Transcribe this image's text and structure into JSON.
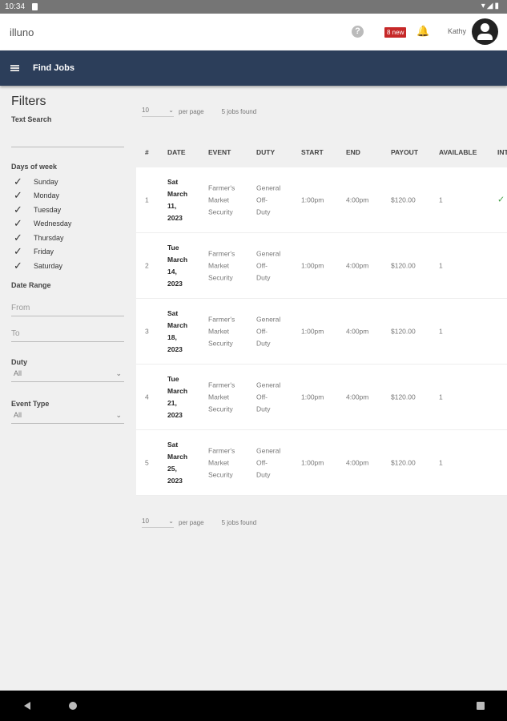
{
  "status": {
    "time": "10:34",
    "icons": "▾◢▮"
  },
  "header": {
    "app_title": "illuno",
    "help": "?",
    "badge": "8 new",
    "bell": "🔔",
    "user": "Kathy"
  },
  "nav": {
    "title": "Find Jobs"
  },
  "filters": {
    "title": "Filters",
    "text_search_label": "Text Search",
    "days_label": "Days of week",
    "days": [
      "Sunday",
      "Monday",
      "Tuesday",
      "Wednesday",
      "Thursday",
      "Friday",
      "Saturday"
    ],
    "date_range_label": "Date Range",
    "from_placeholder": "From",
    "to_placeholder": "To",
    "duty_label": "Duty",
    "duty_value": "All",
    "event_type_label": "Event Type",
    "event_type_value": "All"
  },
  "pager": {
    "per_page_value": "10",
    "per_page_label": "per page",
    "found": "5 jobs found"
  },
  "table": {
    "columns": [
      "#",
      "DATE",
      "EVENT",
      "DUTY",
      "START",
      "END",
      "PAYOUT",
      "AVAILABLE",
      "INT"
    ],
    "rows": [
      {
        "n": "1",
        "date": [
          "Sat",
          "March",
          "11,",
          "2023"
        ],
        "event": [
          "Farmer's",
          "Market",
          "Security"
        ],
        "duty": [
          "General",
          "Off-",
          "Duty"
        ],
        "start": "1:00pm",
        "end": "4:00pm",
        "payout": "$120.00",
        "available": "1",
        "int": "✓"
      },
      {
        "n": "2",
        "date": [
          "Tue",
          "March",
          "14,",
          "2023"
        ],
        "event": [
          "Farmer's",
          "Market",
          "Security"
        ],
        "duty": [
          "General",
          "Off-",
          "Duty"
        ],
        "start": "1:00pm",
        "end": "4:00pm",
        "payout": "$120.00",
        "available": "1",
        "int": ""
      },
      {
        "n": "3",
        "date": [
          "Sat",
          "March",
          "18,",
          "2023"
        ],
        "event": [
          "Farmer's",
          "Market",
          "Security"
        ],
        "duty": [
          "General",
          "Off-",
          "Duty"
        ],
        "start": "1:00pm",
        "end": "4:00pm",
        "payout": "$120.00",
        "available": "1",
        "int": ""
      },
      {
        "n": "4",
        "date": [
          "Tue",
          "March",
          "21,",
          "2023"
        ],
        "event": [
          "Farmer's",
          "Market",
          "Security"
        ],
        "duty": [
          "General",
          "Off-",
          "Duty"
        ],
        "start": "1:00pm",
        "end": "4:00pm",
        "payout": "$120.00",
        "available": "1",
        "int": ""
      },
      {
        "n": "5",
        "date": [
          "Sat",
          "March",
          "25,",
          "2023"
        ],
        "event": [
          "Farmer's",
          "Market",
          "Security"
        ],
        "duty": [
          "General",
          "Off-",
          "Duty"
        ],
        "start": "1:00pm",
        "end": "4:00pm",
        "payout": "$120.00",
        "available": "1",
        "int": ""
      }
    ]
  }
}
